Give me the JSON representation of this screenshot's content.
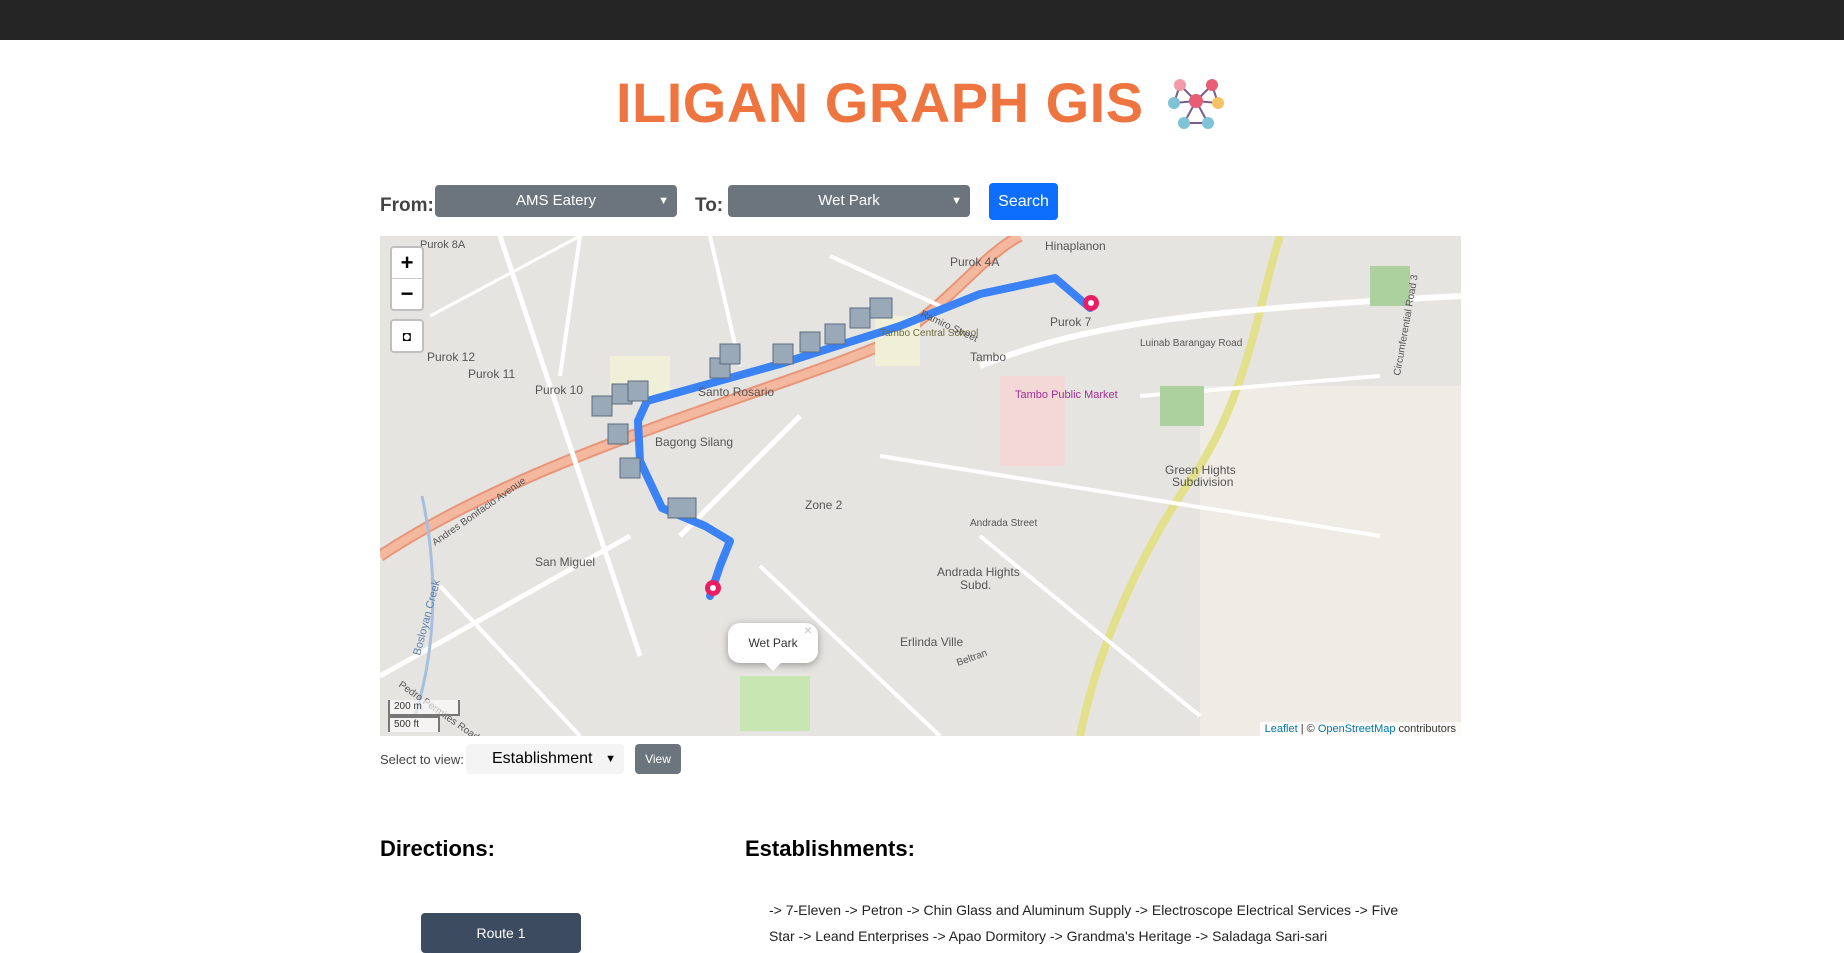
{
  "header": {
    "title": "ILIGAN GRAPH GIS",
    "logo_icon": "graph-network-icon"
  },
  "search_form": {
    "from_label": "From:",
    "from_value": "AMS Eatery",
    "to_label": "To:",
    "to_value": "Wet Park",
    "search_button": "Search"
  },
  "map": {
    "zoom_in": "+",
    "zoom_out": "−",
    "draw_control_icon": "square-draw-icon",
    "popup_text": "Wet Park",
    "popup_close": "×",
    "scale_metric": "200 m",
    "scale_imperial": "500 ft",
    "attribution_leaflet": "Leaflet",
    "attribution_sep": " | © ",
    "attribution_osm": "OpenStreetMap",
    "attribution_tail": " contributors",
    "labels": [
      "Hinaplanon",
      "Purok 4A",
      "Purok 7",
      "Luinab Barangay Road",
      "Tambo",
      "Tambo Public Market",
      "Tambo Central School",
      "Santo Rosario",
      "Bagong Silang",
      "Purok 10",
      "Purok 11",
      "Purok 12",
      "Purok 8A",
      "Zone 2",
      "Andrada Street",
      "Andrada Hights Subd.",
      "Green Hights Subdivision",
      "San Miguel",
      "Erlinda Ville",
      "Circumferential Road 3",
      "Andres Bonifacio Avenue",
      "Ramiro Street",
      "Beltran",
      "Pedro Permites Road",
      "Bosloyan Creek"
    ],
    "route_color": "#3b82f6"
  },
  "view_controls": {
    "label": "Select to view:",
    "select_value": "Establishment",
    "view_button": "View"
  },
  "directions": {
    "heading": "Directions:",
    "route_button": "Route 1"
  },
  "establishments": {
    "heading": "Establishments:",
    "text": "-> 7-Eleven -> Petron -> Chin Glass and Aluminum Supply -> Electroscope Electrical Services -> Five Star -> Leand Enterprises -> Apao Dormitory -> Grandma's Heritage -> Saladaga Sari-sari"
  }
}
